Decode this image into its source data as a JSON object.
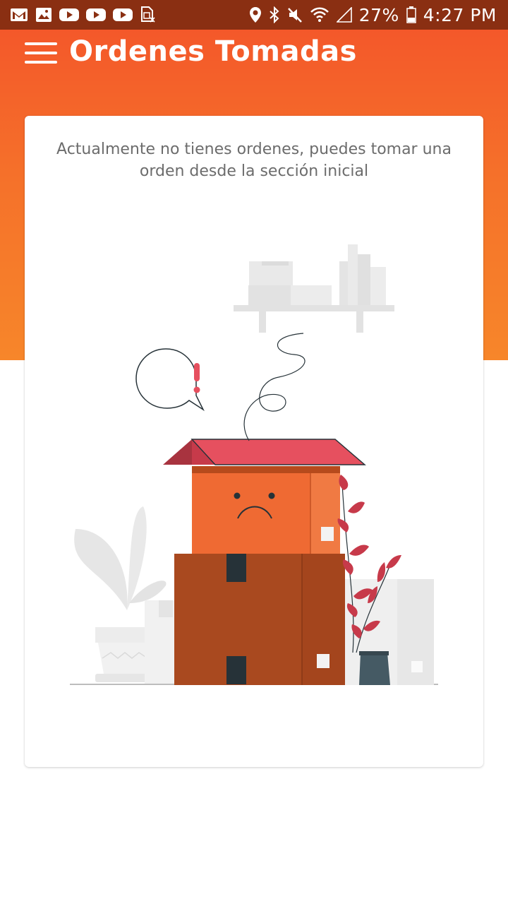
{
  "status_bar": {
    "left_icons": [
      "gmail-icon",
      "gallery-icon",
      "youtube-icon",
      "youtube-icon",
      "youtube-icon",
      "sim-card-icon"
    ],
    "right_icons": [
      "location-icon",
      "bluetooth-icon",
      "mute-icon",
      "wifi-icon",
      "signal-icon",
      "battery-icon"
    ],
    "battery": "27%",
    "time": "4:27 PM"
  },
  "app_bar": {
    "menu_icon": "hamburger-menu-icon",
    "title": "Ordenes Tomadas"
  },
  "empty_state": {
    "message": "Actualmente no tienes ordenes, puedes tomar una orden desde la sección inicial",
    "illustration": "sad-boxes-illustration"
  },
  "colors": {
    "status_bar": "#8a2f12",
    "header_top": "#f4582a",
    "header_bottom": "#f7862a",
    "box_lid": "#e6505f",
    "box_top": "#ef6a33",
    "box_bottom": "#a9491f",
    "plant_leaf": "#c73a4a"
  }
}
